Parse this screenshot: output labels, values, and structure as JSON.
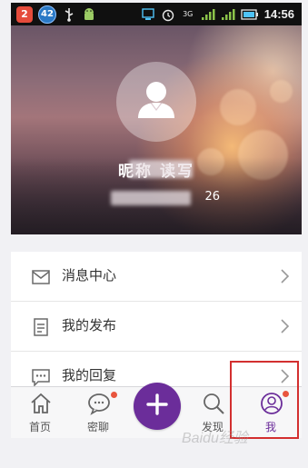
{
  "status_bar": {
    "notif_count_red": "2",
    "notif_count_blue": "42",
    "icons": [
      "usb-icon",
      "android-icon",
      "screen-icon",
      "alarm-icon",
      "3g-icon",
      "signal-icon",
      "signal-icon",
      "battery-icon"
    ],
    "network": "3G",
    "time": "14:56"
  },
  "profile": {
    "username": "昵称 读写",
    "user_id_tail": "26",
    "avatar_icon": "default-user-icon"
  },
  "menu": {
    "items": [
      {
        "label": "消息中心",
        "icon": "mail-icon"
      },
      {
        "label": "我的发布",
        "icon": "document-icon"
      },
      {
        "label": "我的回复",
        "icon": "chat-dots-icon"
      }
    ]
  },
  "tabbar": {
    "tabs": [
      {
        "label": "首页",
        "icon": "home-icon"
      },
      {
        "label": "密聊",
        "icon": "chat-bubble-icon",
        "has_dot": true
      },
      {
        "label": "",
        "icon": "plus-icon"
      },
      {
        "label": "发现",
        "icon": "search-icon"
      },
      {
        "label": "我",
        "icon": "user-circle-icon",
        "has_dot": true,
        "active": true
      }
    ]
  },
  "colors": {
    "accent": "#6b2d9a",
    "dot": "#e8553e",
    "highlight": "#d32f2f"
  },
  "watermark": "Baidu经验"
}
